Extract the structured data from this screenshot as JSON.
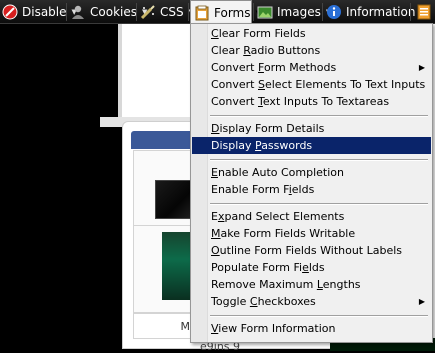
{
  "toolbar": {
    "items": [
      {
        "label": "Disable",
        "icon": "disable-icon"
      },
      {
        "label": "Cookies",
        "icon": "cookies-icon"
      },
      {
        "label": "CSS",
        "icon": "css-icon"
      },
      {
        "label": "Forms",
        "icon": "forms-icon"
      },
      {
        "label": "Images",
        "icon": "images-icon"
      },
      {
        "label": "Information",
        "icon": "information-icon"
      }
    ],
    "overflow_icon": "miscellaneous-icon"
  },
  "page": {
    "bottom_box_text": "M",
    "bottom_text": "e9ins 9",
    "matrix_text": "10010101011010111"
  },
  "menu": {
    "items": [
      {
        "pre": "",
        "key": "C",
        "post": "lear Form Fields",
        "submenu": false
      },
      {
        "pre": "Clear ",
        "key": "R",
        "post": "adio Buttons",
        "submenu": false
      },
      {
        "pre": "Convert ",
        "key": "F",
        "post": "orm Methods",
        "submenu": true
      },
      {
        "pre": "Convert ",
        "key": "S",
        "post": "elect Elements To Text Inputs",
        "submenu": false
      },
      {
        "pre": "Convert ",
        "key": "T",
        "post": "ext Inputs To Textareas",
        "submenu": false
      },
      {
        "pre": "",
        "key": "D",
        "post": "isplay Form Details",
        "submenu": false
      },
      {
        "pre": "Display ",
        "key": "P",
        "post": "asswords",
        "submenu": false,
        "highlighted": true
      },
      {
        "pre": "",
        "key": "E",
        "post": "nable Auto Completion",
        "submenu": false
      },
      {
        "pre": "Enable Form F",
        "key": "i",
        "post": "elds",
        "submenu": false
      },
      {
        "pre": "E",
        "key": "x",
        "post": "pand Select Elements",
        "submenu": false
      },
      {
        "pre": "",
        "key": "M",
        "post": "ake Form Fields Writable",
        "submenu": false
      },
      {
        "pre": "",
        "key": "O",
        "post": "utline Form Fields Without Labels",
        "submenu": false
      },
      {
        "pre": "Populate Form Fi",
        "key": "e",
        "post": "lds",
        "submenu": false
      },
      {
        "pre": "Remove Maximum ",
        "key": "L",
        "post": "engths",
        "submenu": false
      },
      {
        "pre": "Toggle ",
        "key": "C",
        "post": "heckboxes",
        "submenu": true
      },
      {
        "pre": "",
        "key": "V",
        "post": "iew Form Information",
        "submenu": false
      }
    ]
  }
}
